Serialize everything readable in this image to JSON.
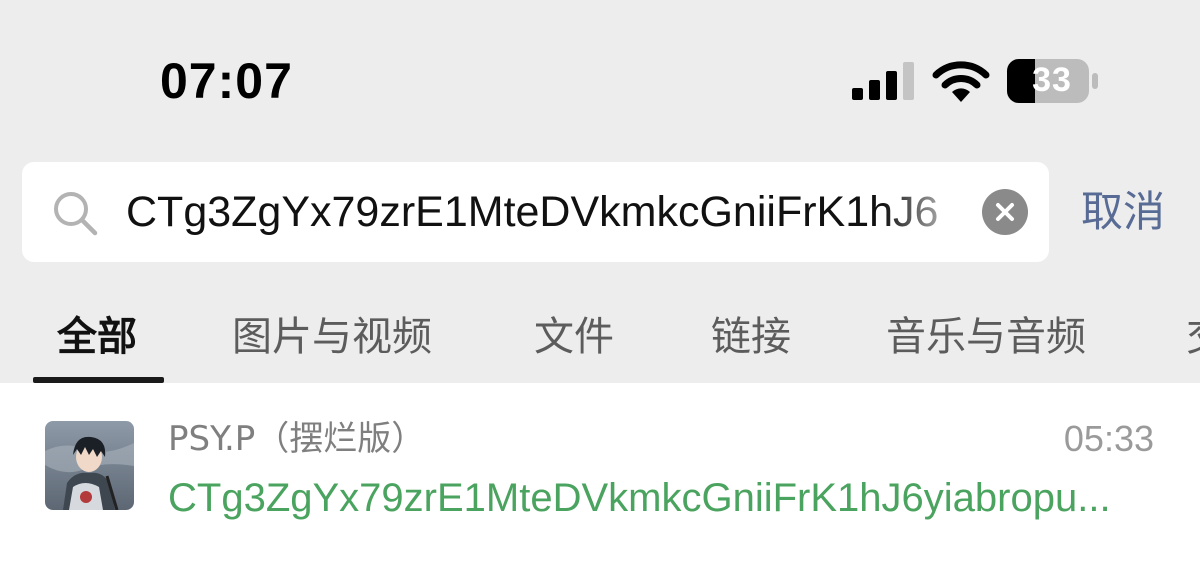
{
  "status_bar": {
    "time": "07:07",
    "battery_level": "33",
    "signal_bars_filled": 3,
    "signal_bars_total": 4
  },
  "search": {
    "query": "CTg3ZgYx79zrE1MteDVkmkcGniiFrK1hJ6",
    "cancel_label": "取消"
  },
  "tabs": [
    {
      "label": "全部",
      "active": true
    },
    {
      "label": "图片与视频",
      "active": false
    },
    {
      "label": "文件",
      "active": false
    },
    {
      "label": "链接",
      "active": false
    },
    {
      "label": "音乐与音频",
      "active": false
    },
    {
      "label": "交",
      "active": false
    }
  ],
  "results": [
    {
      "title": "PSY.P（摆烂版）",
      "time": "05:33",
      "snippet": "CTg3ZgYx79zrE1MteDVkmkcGniiFrK1hJ6yiabropu..."
    }
  ],
  "colors": {
    "background": "#ededed",
    "cancel_link": "#576b95",
    "match_highlight": "#4aa35e"
  }
}
